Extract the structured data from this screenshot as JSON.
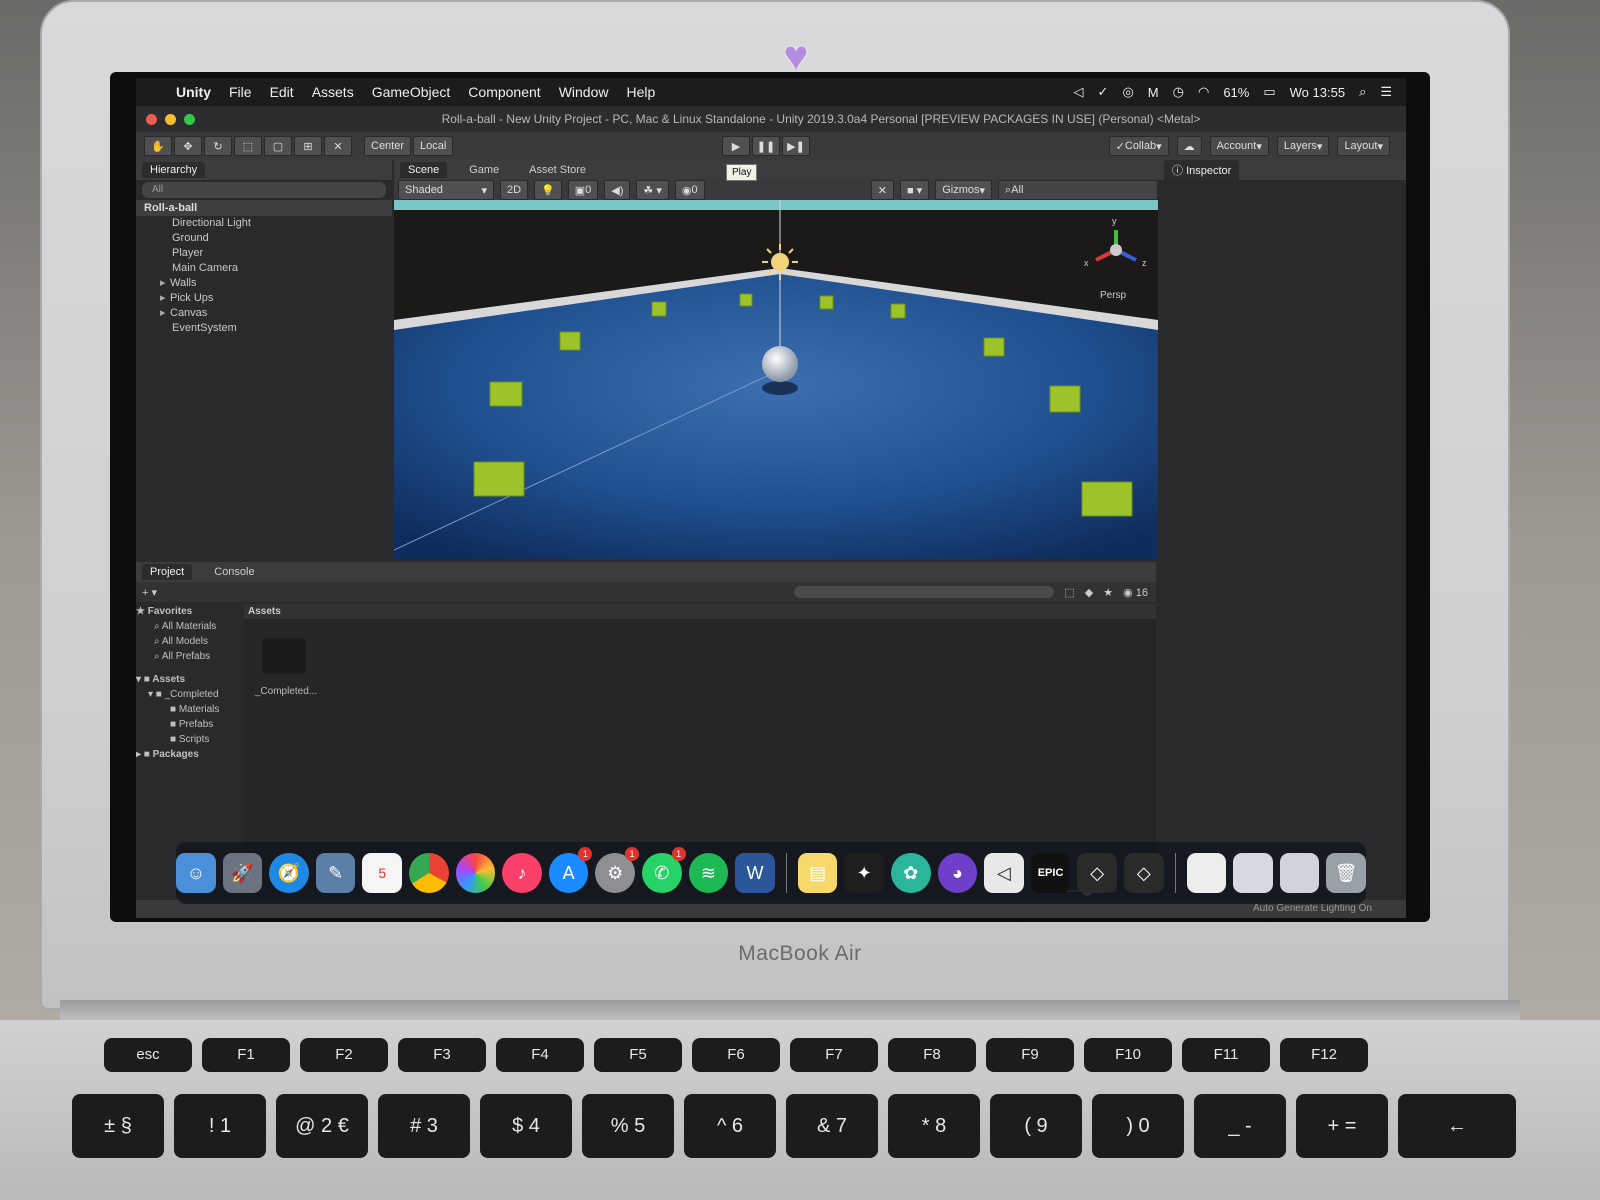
{
  "menubar": {
    "app_name": "Unity",
    "menus": [
      "File",
      "Edit",
      "Assets",
      "GameObject",
      "Component",
      "Window",
      "Help"
    ],
    "battery": "61%",
    "clock": "Wo 13:55"
  },
  "window": {
    "title": "Roll-a-ball - New Unity Project - PC, Mac & Linux Standalone - Unity 2019.3.0a4 Personal [PREVIEW PACKAGES IN USE] (Personal) <Metal>"
  },
  "toolbar": {
    "pivot_label": "Center",
    "space_label": "Local",
    "play_tooltip": "Play",
    "collab_label": "Collab",
    "account_label": "Account",
    "layers_label": "Layers",
    "layout_label": "Layout"
  },
  "hierarchy": {
    "tab": "Hierarchy",
    "search_placeholder": "All",
    "root": "Roll-a-ball",
    "items": [
      "Directional Light",
      "Ground",
      "Player",
      "Main Camera",
      "Walls",
      "Pick Ups",
      "Canvas",
      "EventSystem"
    ]
  },
  "scene": {
    "tabs": [
      "Scene",
      "Game",
      "Asset Store"
    ],
    "shading": "Shaded",
    "mode_2d": "2D",
    "gizmos_label": "Gizmos",
    "search_placeholder": "All",
    "persp_label": "Persp",
    "fx_count": "0",
    "audio_count": "0",
    "axis_x": "x",
    "axis_y": "y",
    "axis_z": "z"
  },
  "inspector": {
    "tab": "Inspector"
  },
  "project": {
    "tabs": [
      "Project",
      "Console"
    ],
    "hidden_count": "16",
    "favorites_label": "Favorites",
    "favorites": [
      "All Materials",
      "All Models",
      "All Prefabs"
    ],
    "assets_label": "Assets",
    "tree": [
      "_Completed",
      "Materials",
      "Prefabs",
      "Scripts"
    ],
    "packages_label": "Packages",
    "breadcrumb": "Assets",
    "folder_name": "_Completed..."
  },
  "status": {
    "text": "Auto Generate Lighting On"
  },
  "dock": {
    "calendar_day": "5",
    "word_label": "W",
    "epic_label": "EPIC",
    "badges": [
      "1",
      "1",
      "1"
    ]
  },
  "laptop": {
    "brand": "MacBook Air"
  },
  "keyboard": {
    "fn_row": [
      "esc",
      "F1",
      "F2",
      "F3",
      "F4",
      "F5",
      "F6",
      "F7",
      "F8",
      "F9",
      "F10",
      "F11",
      "F12"
    ],
    "num_row": [
      "± §",
      "! 1",
      "@ 2 €",
      "# 3",
      "$ 4",
      "% 5",
      "^ 6",
      "& 7",
      "* 8",
      "( 9",
      ") 0",
      "_ -",
      "+ ="
    ]
  },
  "colors": {
    "unity_dark": "#2a2a2c",
    "floor_blue": "#1f4f8f",
    "pickup_green": "#9cc32a",
    "close_red": "#ee5b50",
    "minimize_yellow": "#f5bd2e",
    "zoom_green": "#35c74a"
  }
}
